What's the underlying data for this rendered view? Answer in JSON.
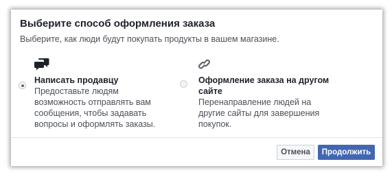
{
  "dialog": {
    "title": "Выберите способ оформления заказа",
    "subtitle": "Выберите, как люди будут покупать продукты в вашем магазине."
  },
  "options": [
    {
      "icon": "chat-bubbles-icon",
      "title": "Написать продавцу",
      "description_lines": [
        "Предоставьте людям",
        "возможность отправлять вам",
        "сообщения, чтобы задавать",
        "вопросы и оформлять заказы."
      ],
      "selected": true
    },
    {
      "icon": "link-icon",
      "title_lines": [
        "Оформление заказа на другом",
        "сайте"
      ],
      "description_lines": [
        "Перенаправление людей на",
        "другие сайты для завершения",
        "покупок."
      ],
      "selected": false
    }
  ],
  "footer": {
    "cancel_label": "Отмена",
    "continue_label": "Продолжить"
  },
  "colors": {
    "primary": "#4267b2",
    "text": "#1d2129",
    "secondary_text": "#4b4f56"
  }
}
